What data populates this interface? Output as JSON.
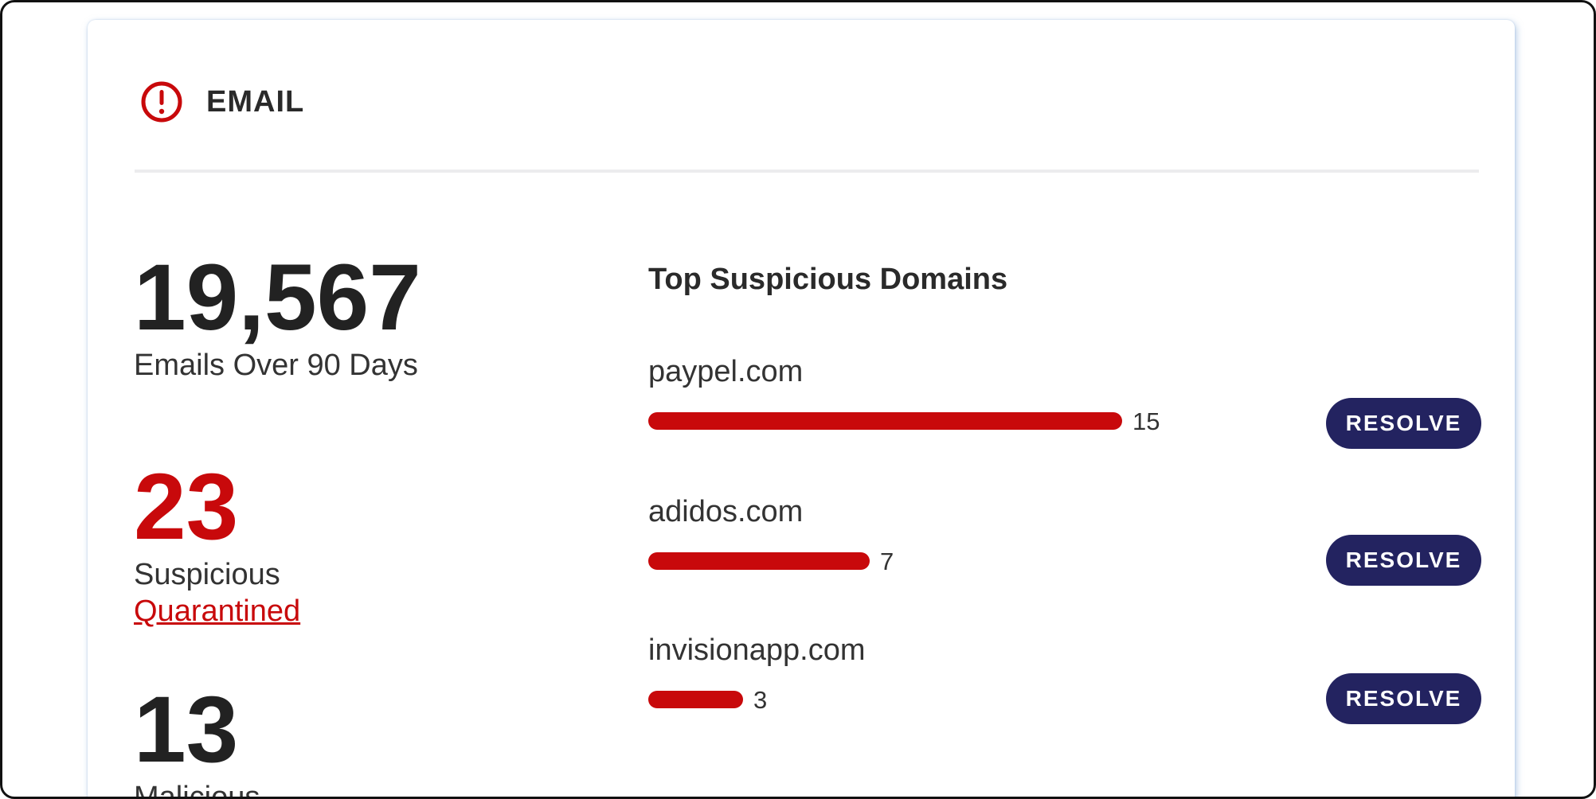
{
  "header": {
    "icon": "alert-circle-icon",
    "title": "EMAIL",
    "accent_color": "#c8090b"
  },
  "stats": {
    "emails": {
      "value": "19,567",
      "label": "Emails Over 90 Days"
    },
    "suspicious": {
      "value": "23",
      "label": "Suspicious",
      "link": "Quarantined",
      "color": "#c8090b"
    },
    "malicious": {
      "value": "13",
      "label": "Malicious"
    }
  },
  "domains": {
    "title": "Top Suspicious Domains",
    "max_count": 15,
    "bar_color": "#c8090b",
    "button_color": "#232360",
    "items": [
      {
        "name": "paypel.com",
        "count": 15,
        "action": "RESOLVE"
      },
      {
        "name": "adidos.com",
        "count": 7,
        "action": "RESOLVE"
      },
      {
        "name": "invisionapp.com",
        "count": 3,
        "action": "RESOLVE"
      }
    ]
  }
}
